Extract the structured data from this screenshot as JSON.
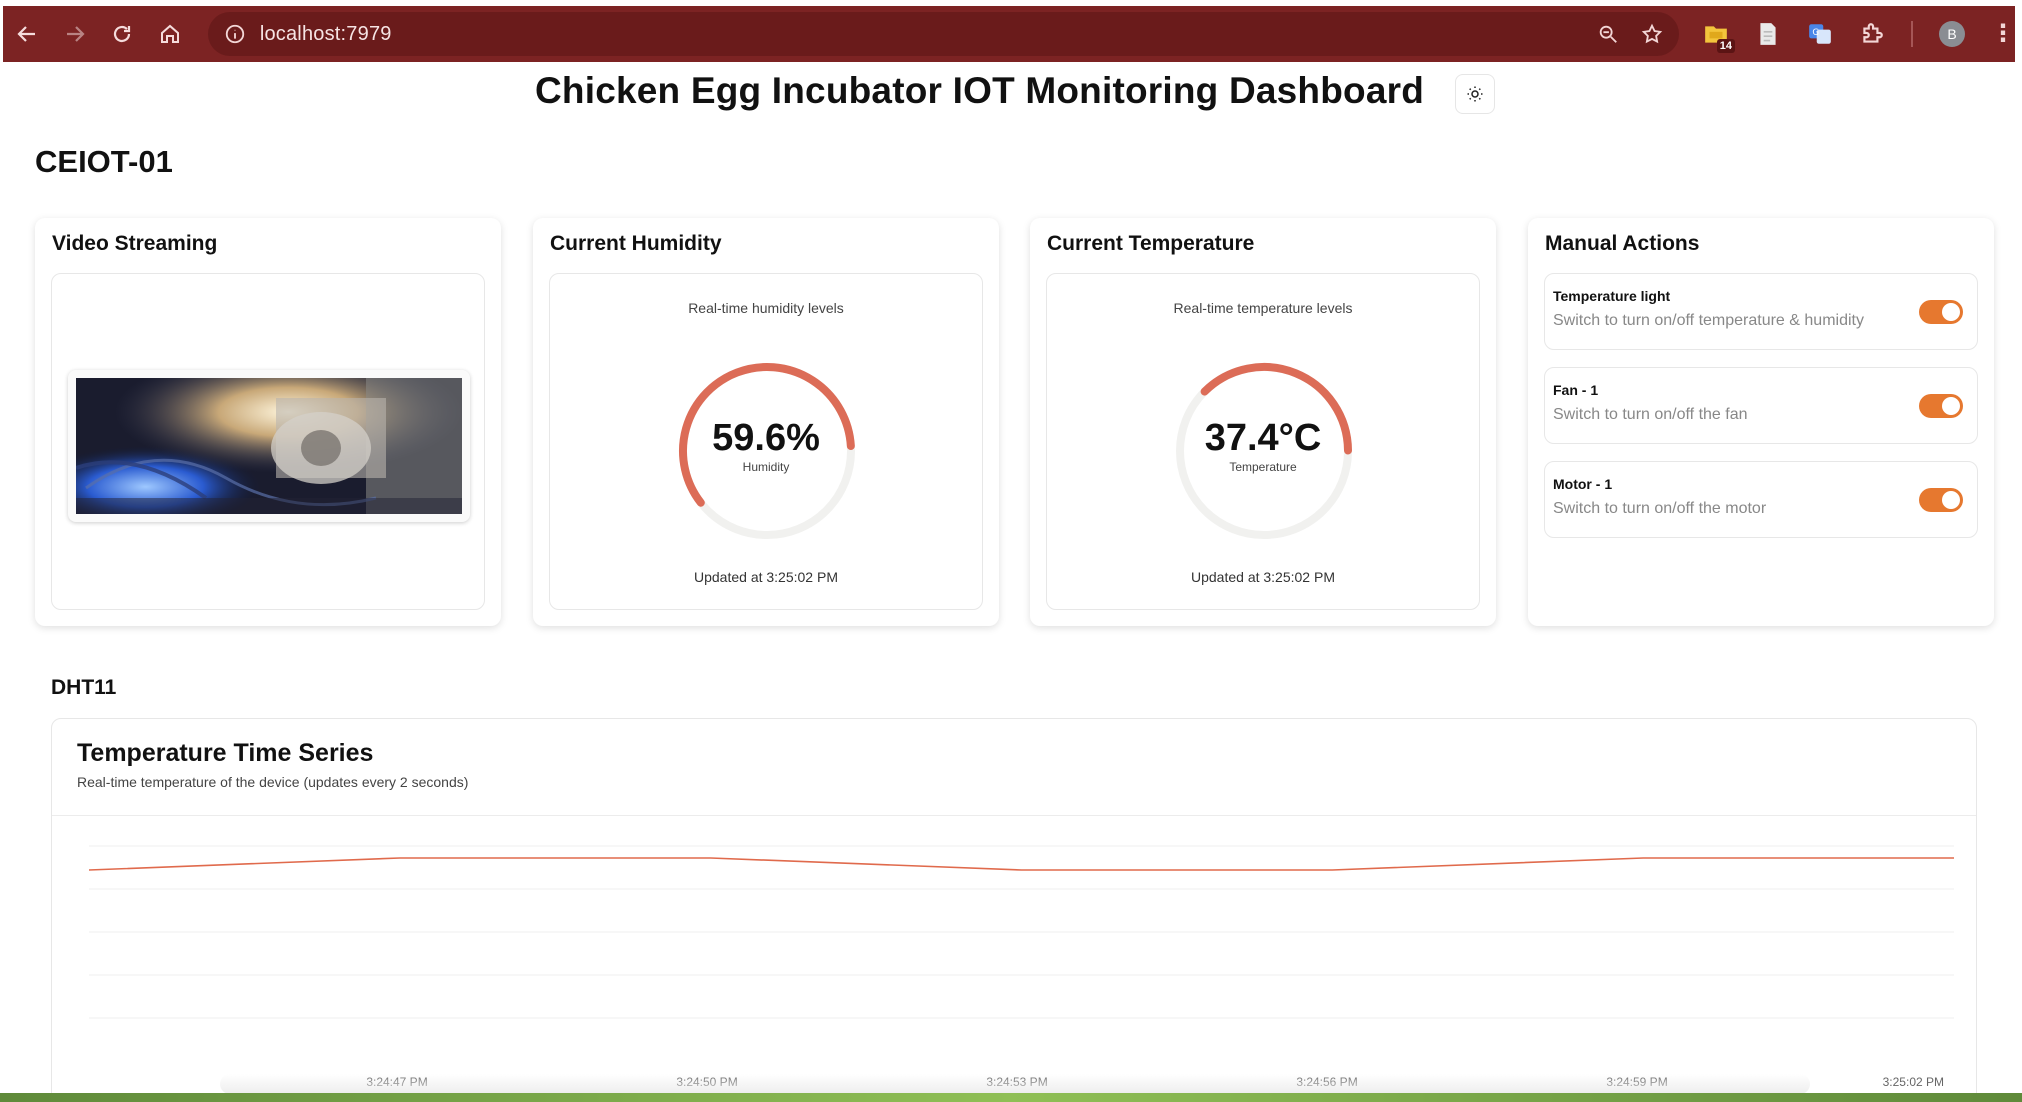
{
  "browser": {
    "url": "localhost:7979",
    "extension_badge": "14",
    "profile_initial": "B"
  },
  "header": {
    "title": "Chicken Egg Incubator IOT Monitoring Dashboard"
  },
  "device": {
    "name": "CEIOT-01"
  },
  "cards": {
    "video": {
      "title": "Video Streaming"
    },
    "humidity": {
      "title": "Current Humidity",
      "subtitle": "Real-time humidity levels",
      "value": "59.6%",
      "label": "Humidity",
      "updated": "Updated at 3:25:02 PM",
      "fraction": 0.596
    },
    "temperature": {
      "title": "Current Temperature",
      "subtitle": "Real-time temperature levels",
      "value": "37.4°C",
      "label": "Temperature",
      "updated": "Updated at 3:25:02 PM",
      "fraction": 0.374
    },
    "actions": {
      "title": "Manual Actions",
      "items": [
        {
          "title": "Temperature light",
          "description": "Switch to turn on/off temperature & humidity",
          "on": true
        },
        {
          "title": "Fan - 1",
          "description": "Switch to turn on/off the fan",
          "on": true
        },
        {
          "title": "Motor - 1",
          "description": "Switch to turn on/off the motor",
          "on": true
        }
      ]
    }
  },
  "sensor_section": {
    "title": "DHT11"
  },
  "chart_data": {
    "type": "line",
    "title": "Temperature Time Series",
    "subtitle": "Real-time temperature of the device (updates every 2 seconds)",
    "x_ticks": [
      "3:24:47 PM",
      "3:24:50 PM",
      "3:24:53 PM",
      "3:24:56 PM",
      "3:24:59 PM",
      "3:25:02 PM"
    ],
    "series": [
      {
        "color": "#e06a4c",
        "x": [
          "3:24:44 PM",
          "3:24:47 PM",
          "3:24:50 PM",
          "3:24:53 PM",
          "3:24:56 PM",
          "3:24:59 PM",
          "3:25:02 PM"
        ],
        "values": [
          37.3,
          37.4,
          37.4,
          37.3,
          37.3,
          37.4,
          37.4
        ]
      }
    ],
    "grid": true,
    "accent_color": "#e06a4c"
  }
}
